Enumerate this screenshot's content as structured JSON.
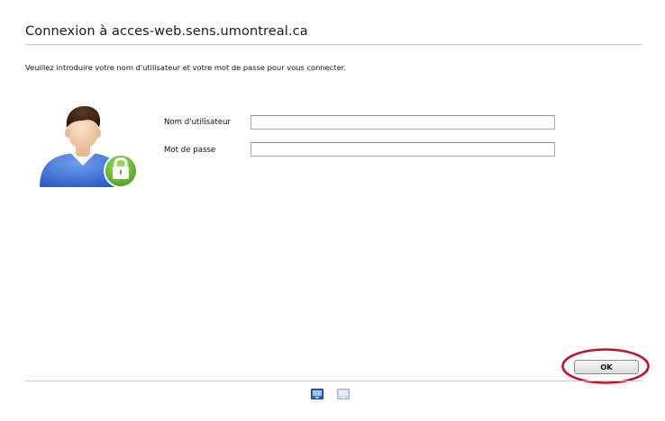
{
  "dialog": {
    "title": "Connexion à acces-web.sens.umontreal.ca",
    "instructions": "Veuillez introduire votre nom d'utilisateur et votre mot de passe pour vous connecter."
  },
  "form": {
    "username_label": "Nom d'utilisateur",
    "username_value": "",
    "password_label": "Mot de passe",
    "password_value": ""
  },
  "buttons": {
    "ok_label": "OK"
  },
  "icons": {
    "avatar": "user-avatar-with-lock-icon",
    "lock_badge": "lock-icon",
    "footer_left": "network-connection-icon",
    "footer_right": "network-connection-icon"
  },
  "colors": {
    "highlight": "#c8102e",
    "lock_badge": "#6dbf2b",
    "shirt": "#3a6fd0"
  }
}
